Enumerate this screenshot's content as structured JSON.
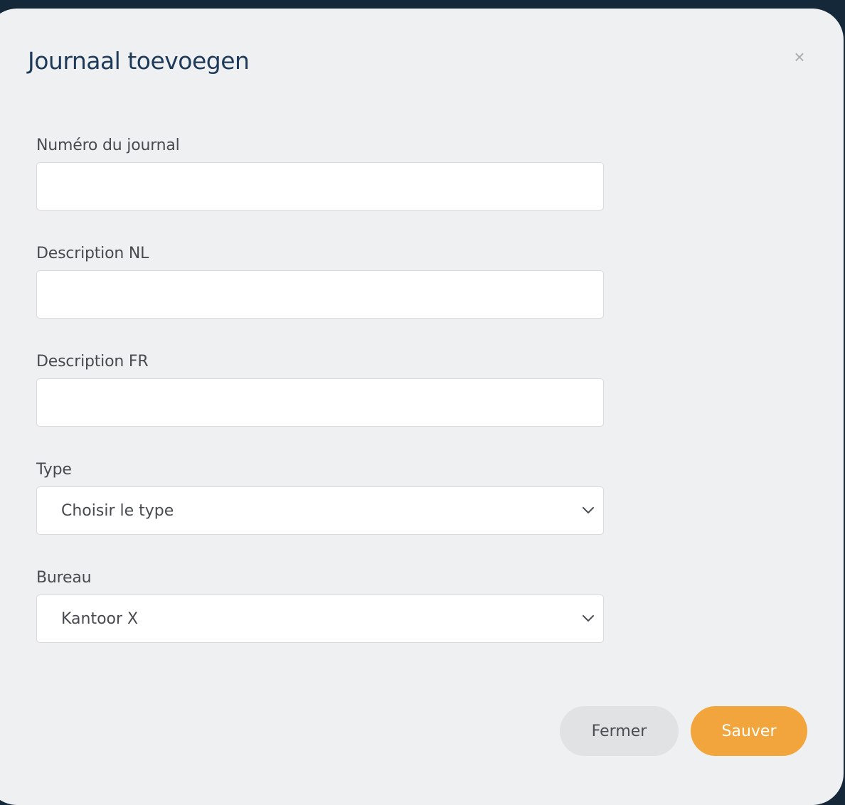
{
  "modal": {
    "title": "Journaal toevoegen",
    "close_symbol": "×"
  },
  "fields": {
    "journal_number": {
      "label": "Numéro du journal",
      "value": ""
    },
    "description_nl": {
      "label": "Description NL",
      "value": ""
    },
    "description_fr": {
      "label": "Description FR",
      "value": ""
    },
    "type": {
      "label": "Type",
      "selected": "Choisir le type"
    },
    "office": {
      "label": "Bureau",
      "selected": "Kantoor X"
    }
  },
  "buttons": {
    "close_label": "Fermer",
    "save_label": "Sauver"
  },
  "icons": {
    "close": "close-icon",
    "select_chevron": "chevron-down-icon"
  },
  "colors": {
    "backdrop": "#15283a",
    "modal_bg": "#eff0f2",
    "title": "#1e3a58",
    "primary_button": "#f2a53c",
    "secondary_button": "#e1e2e4"
  }
}
